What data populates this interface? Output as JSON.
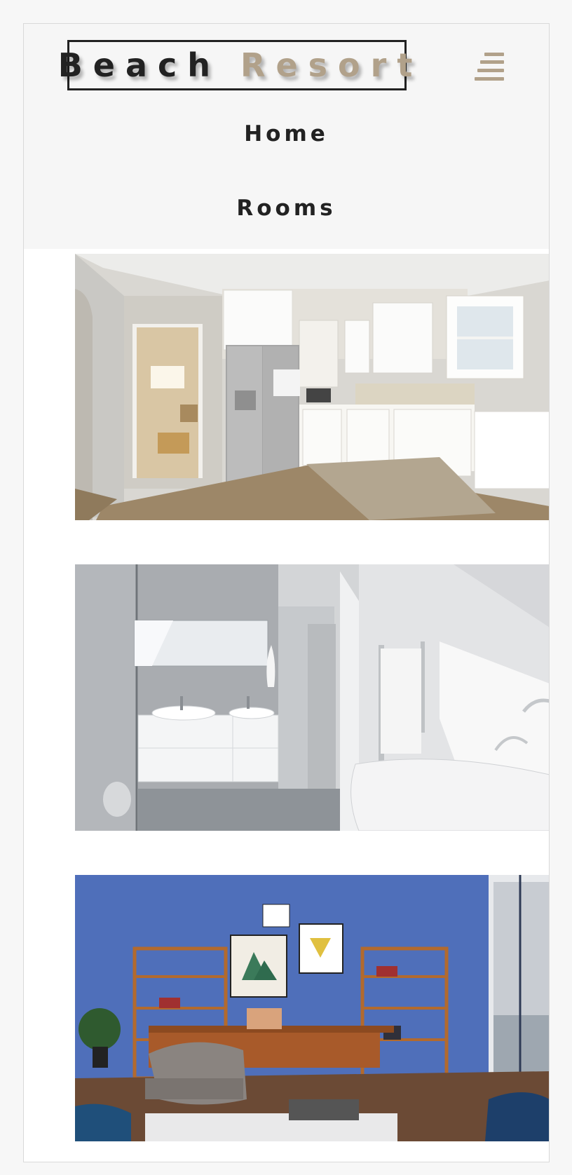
{
  "brand": {
    "word1": "Beach",
    "word2": "Resort",
    "accent_color": "#b1a18a",
    "dark_color": "#222222"
  },
  "menu": {
    "icon": "hamburger-menu-icon"
  },
  "nav": {
    "links": [
      {
        "label": "Home"
      },
      {
        "label": "Rooms"
      }
    ]
  },
  "rooms": [
    {
      "image": "kitchen-photo"
    },
    {
      "image": "bathroom-photo"
    },
    {
      "image": "living-room-photo"
    }
  ]
}
